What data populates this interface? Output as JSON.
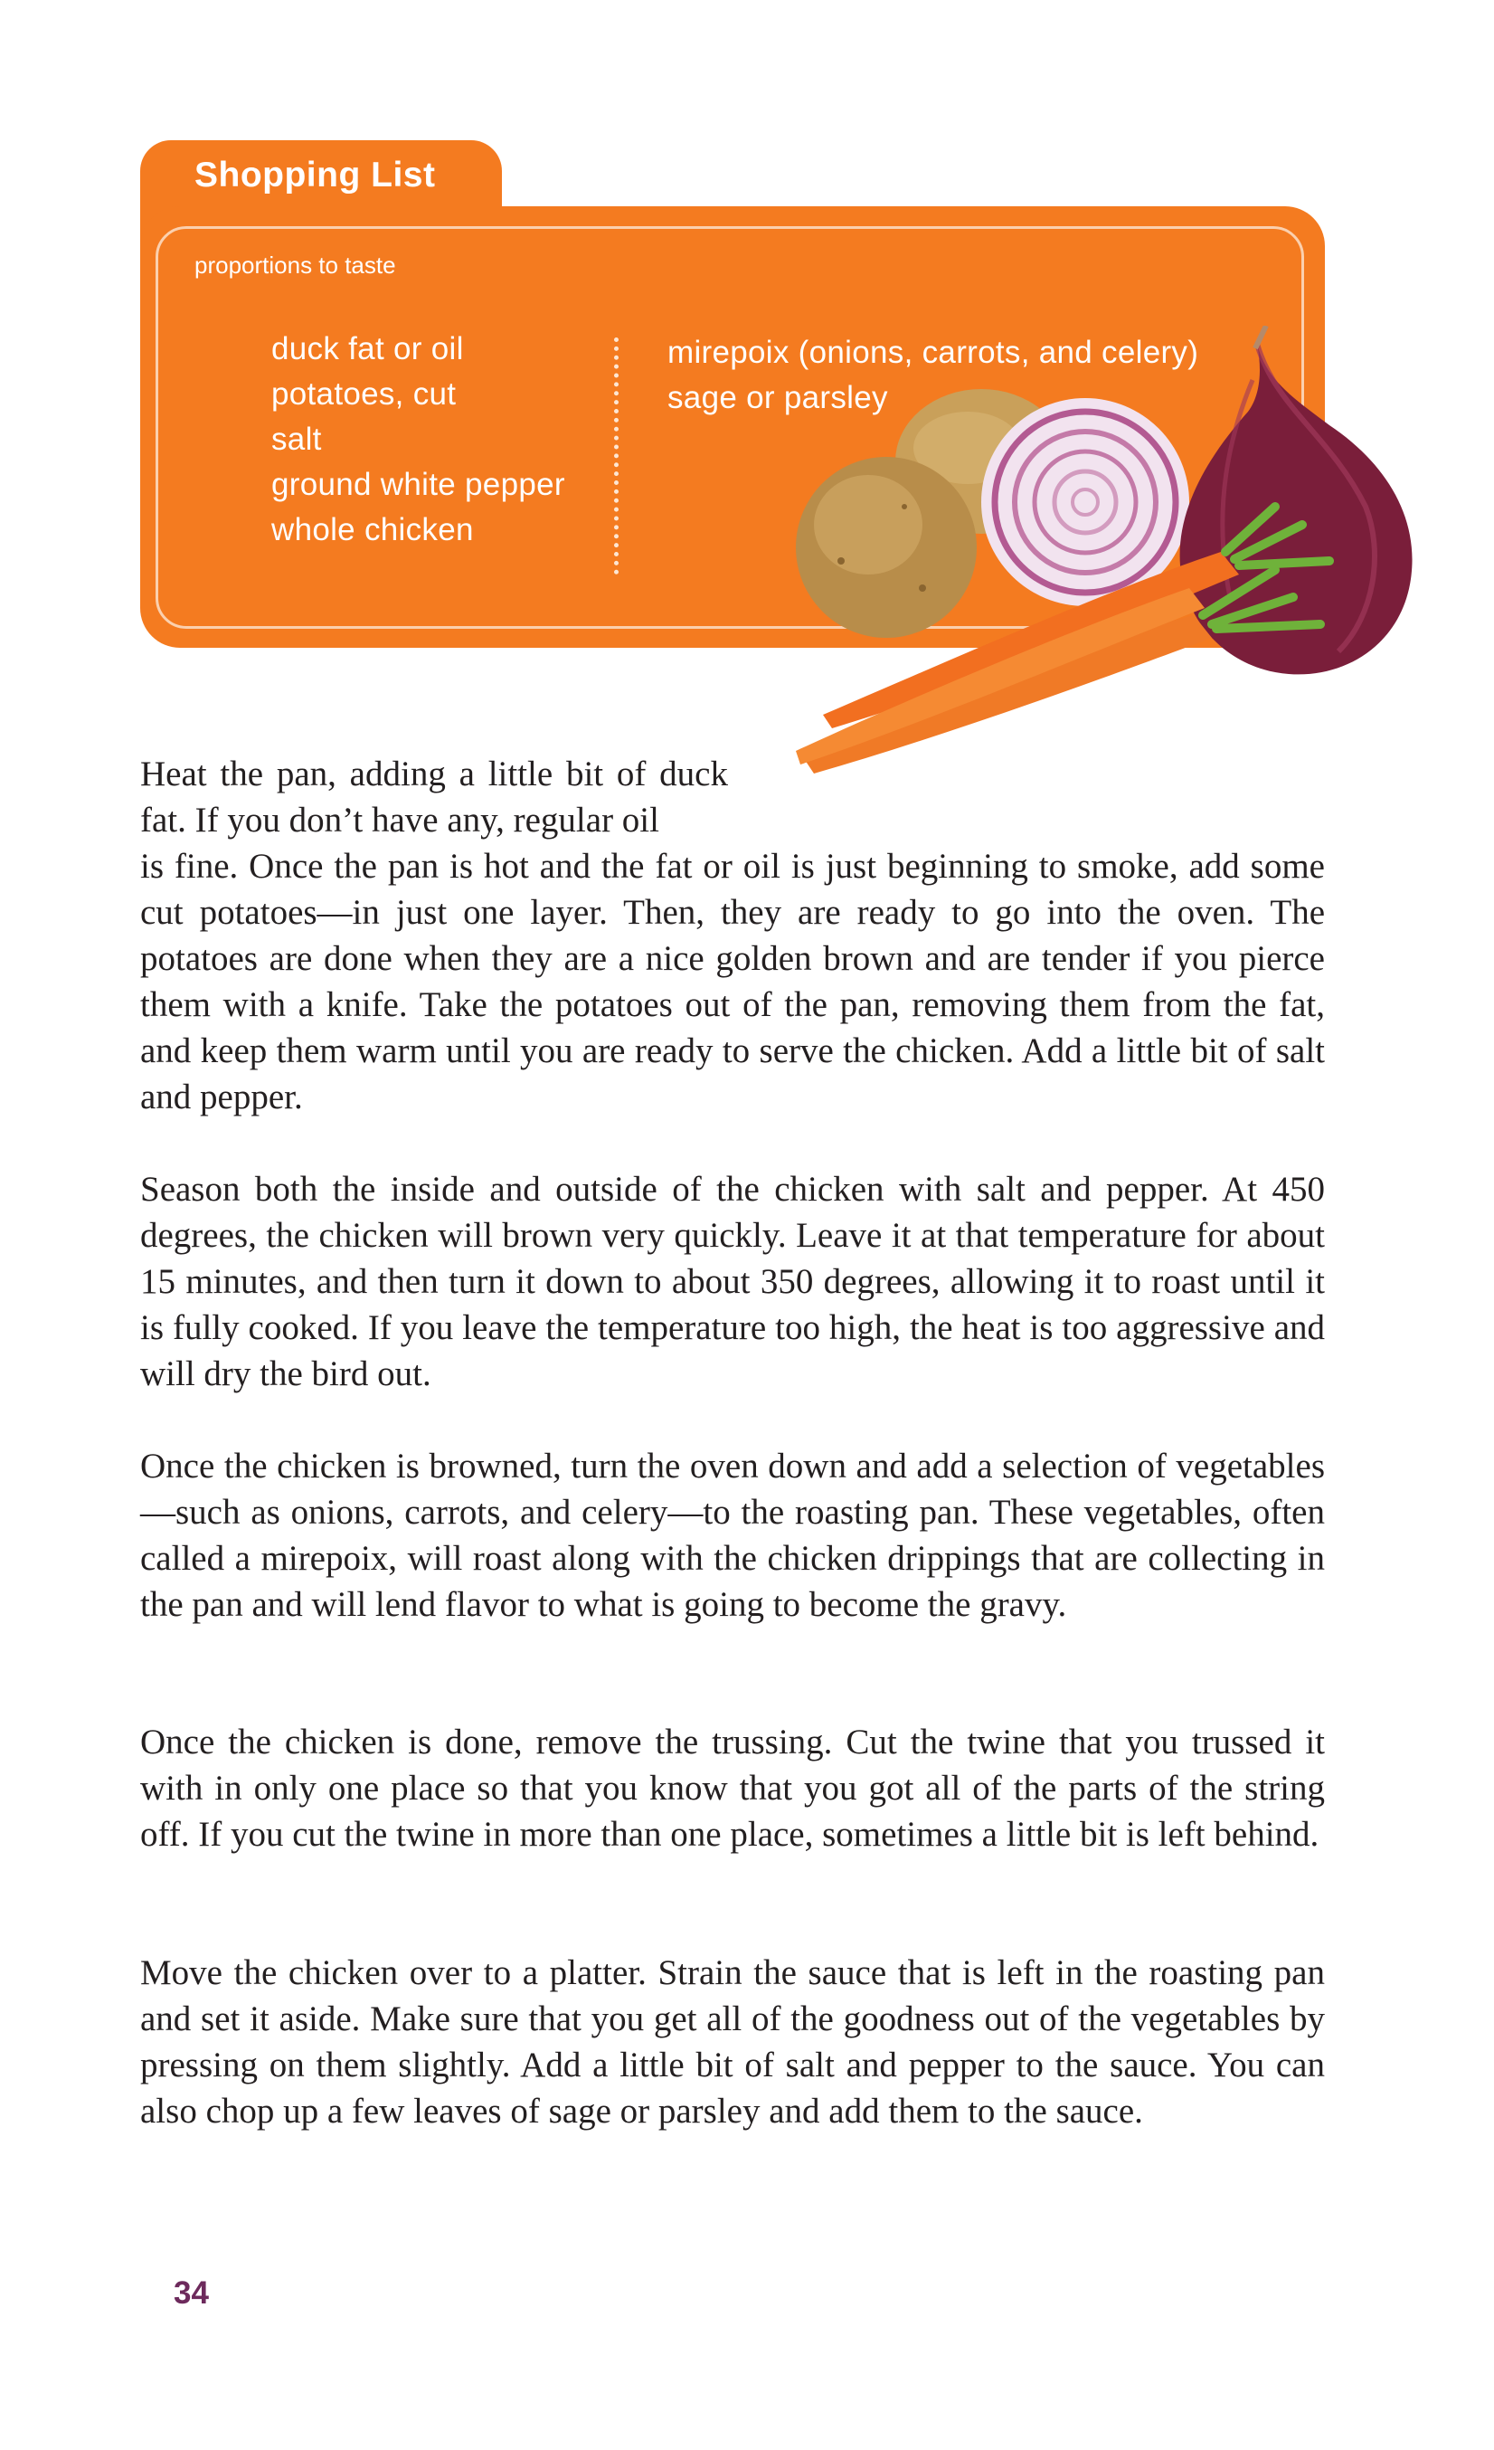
{
  "shopping_list": {
    "title": "Shopping List",
    "subtitle": "proportions to taste",
    "left_items": [
      "duck fat or oil",
      "potatoes, cut",
      "salt",
      "ground white pepper",
      "whole chicken"
    ],
    "right_items": [
      "mirepoix (onions, carrots, and celery)",
      "sage or parsley"
    ]
  },
  "illustration": {
    "icon": "vegetables-illustration",
    "colors": {
      "carrot": "#f07a26",
      "onion": "#7a1e3a",
      "potato": "#c9a05a",
      "accent": "#f47b20"
    }
  },
  "body": {
    "p1_start": "Heat the pan, adding a little bit of duck fat. If you don’t have any, regular oil",
    "p1_rest": "is fine. Once the pan is hot and the fat or oil is just beginning to smoke, add some cut potatoes—in just one layer. Then, they are ready to go into the oven. The potatoes are done when they are a nice golden brown and are tender if you pierce them with a knife. Take the potatoes out of the pan, removing them from the fat, and keep them warm until you are ready to serve the chicken. Add a little bit of salt and pepper.",
    "p2": "Season both the inside and outside of the chicken with salt and pepper. At 450 degrees, the chicken will brown very quickly. Leave it at that temperature for about 15 minutes, and then turn it down to about 350 degrees, allowing it to roast until it is fully cooked. If you leave the temperature too high, the heat is too aggressive and will dry the bird out.",
    "p3": "Once the chicken is browned, turn the oven down and add a selection of vegetables—such as onions, carrots, and celery—to the roasting pan. These vegetables, often called a mirepoix, will roast along with the chicken drippings that are collecting in the pan and will lend flavor to what is going to become the gravy.",
    "p4": "Once the chicken is done, remove the trussing. Cut the twine that you trussed it with in only one place so that you know that you got all of the parts of the string off. If you cut the twine in more than one place, sometimes a little bit is left behind.",
    "p5": "Move the chicken over to a platter. Strain the sauce that is left in the roasting pan and set it aside. Make sure that you get all of the goodness out of the vegetables by pressing on them slightly. Add a little bit of salt and pepper to the sauce. You can also chop up a few leaves of sage or parsley and add them to the sauce."
  },
  "page_number": "34"
}
